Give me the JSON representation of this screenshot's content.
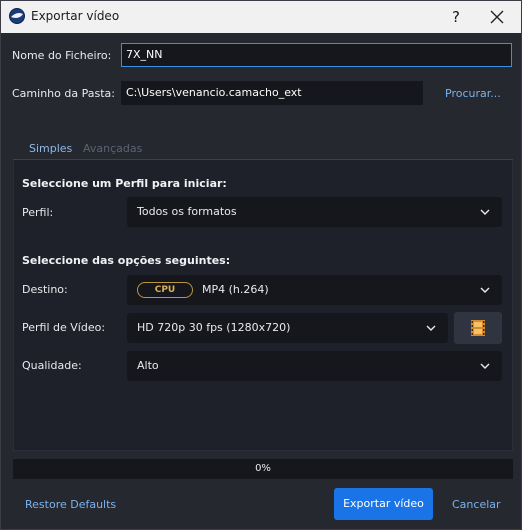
{
  "window": {
    "title": "Exportar vídeo",
    "help_glyph": "?"
  },
  "file_name": {
    "label": "Nome do Ficheiro:",
    "value": "7X_NN"
  },
  "folder_path": {
    "label": "Caminho da Pasta:",
    "value": "C:\\Users\\venancio.camacho_ext",
    "browse_label": "Procurar..."
  },
  "tabs": [
    {
      "label": "Simples",
      "active": true
    },
    {
      "label": "Avançadas",
      "active": false
    }
  ],
  "profile_section": {
    "title": "Seleccione um Perfil para iniciar:",
    "label": "Perfil:",
    "value": "Todos os formatos"
  },
  "options_section": {
    "title": "Seleccione das opções seguintes:",
    "destination": {
      "label": "Destino:",
      "badge": "CPU",
      "value": "MP4 (h.264)"
    },
    "video_profile": {
      "label": "Perfil de Vídeo:",
      "value": "HD 720p 30 fps (1280x720)",
      "edit_icon": "film-icon"
    },
    "quality": {
      "label": "Qualidade:",
      "value": "Alto"
    }
  },
  "progress": {
    "text": "0%",
    "fraction": 0
  },
  "footer": {
    "restore_label": "Restore Defaults",
    "export_label": "Exportar vídeo",
    "cancel_label": "Cancelar"
  },
  "colors": {
    "accent": "#1a74e8",
    "link": "#7ab2ee",
    "cpu_badge": "#b8953e"
  }
}
